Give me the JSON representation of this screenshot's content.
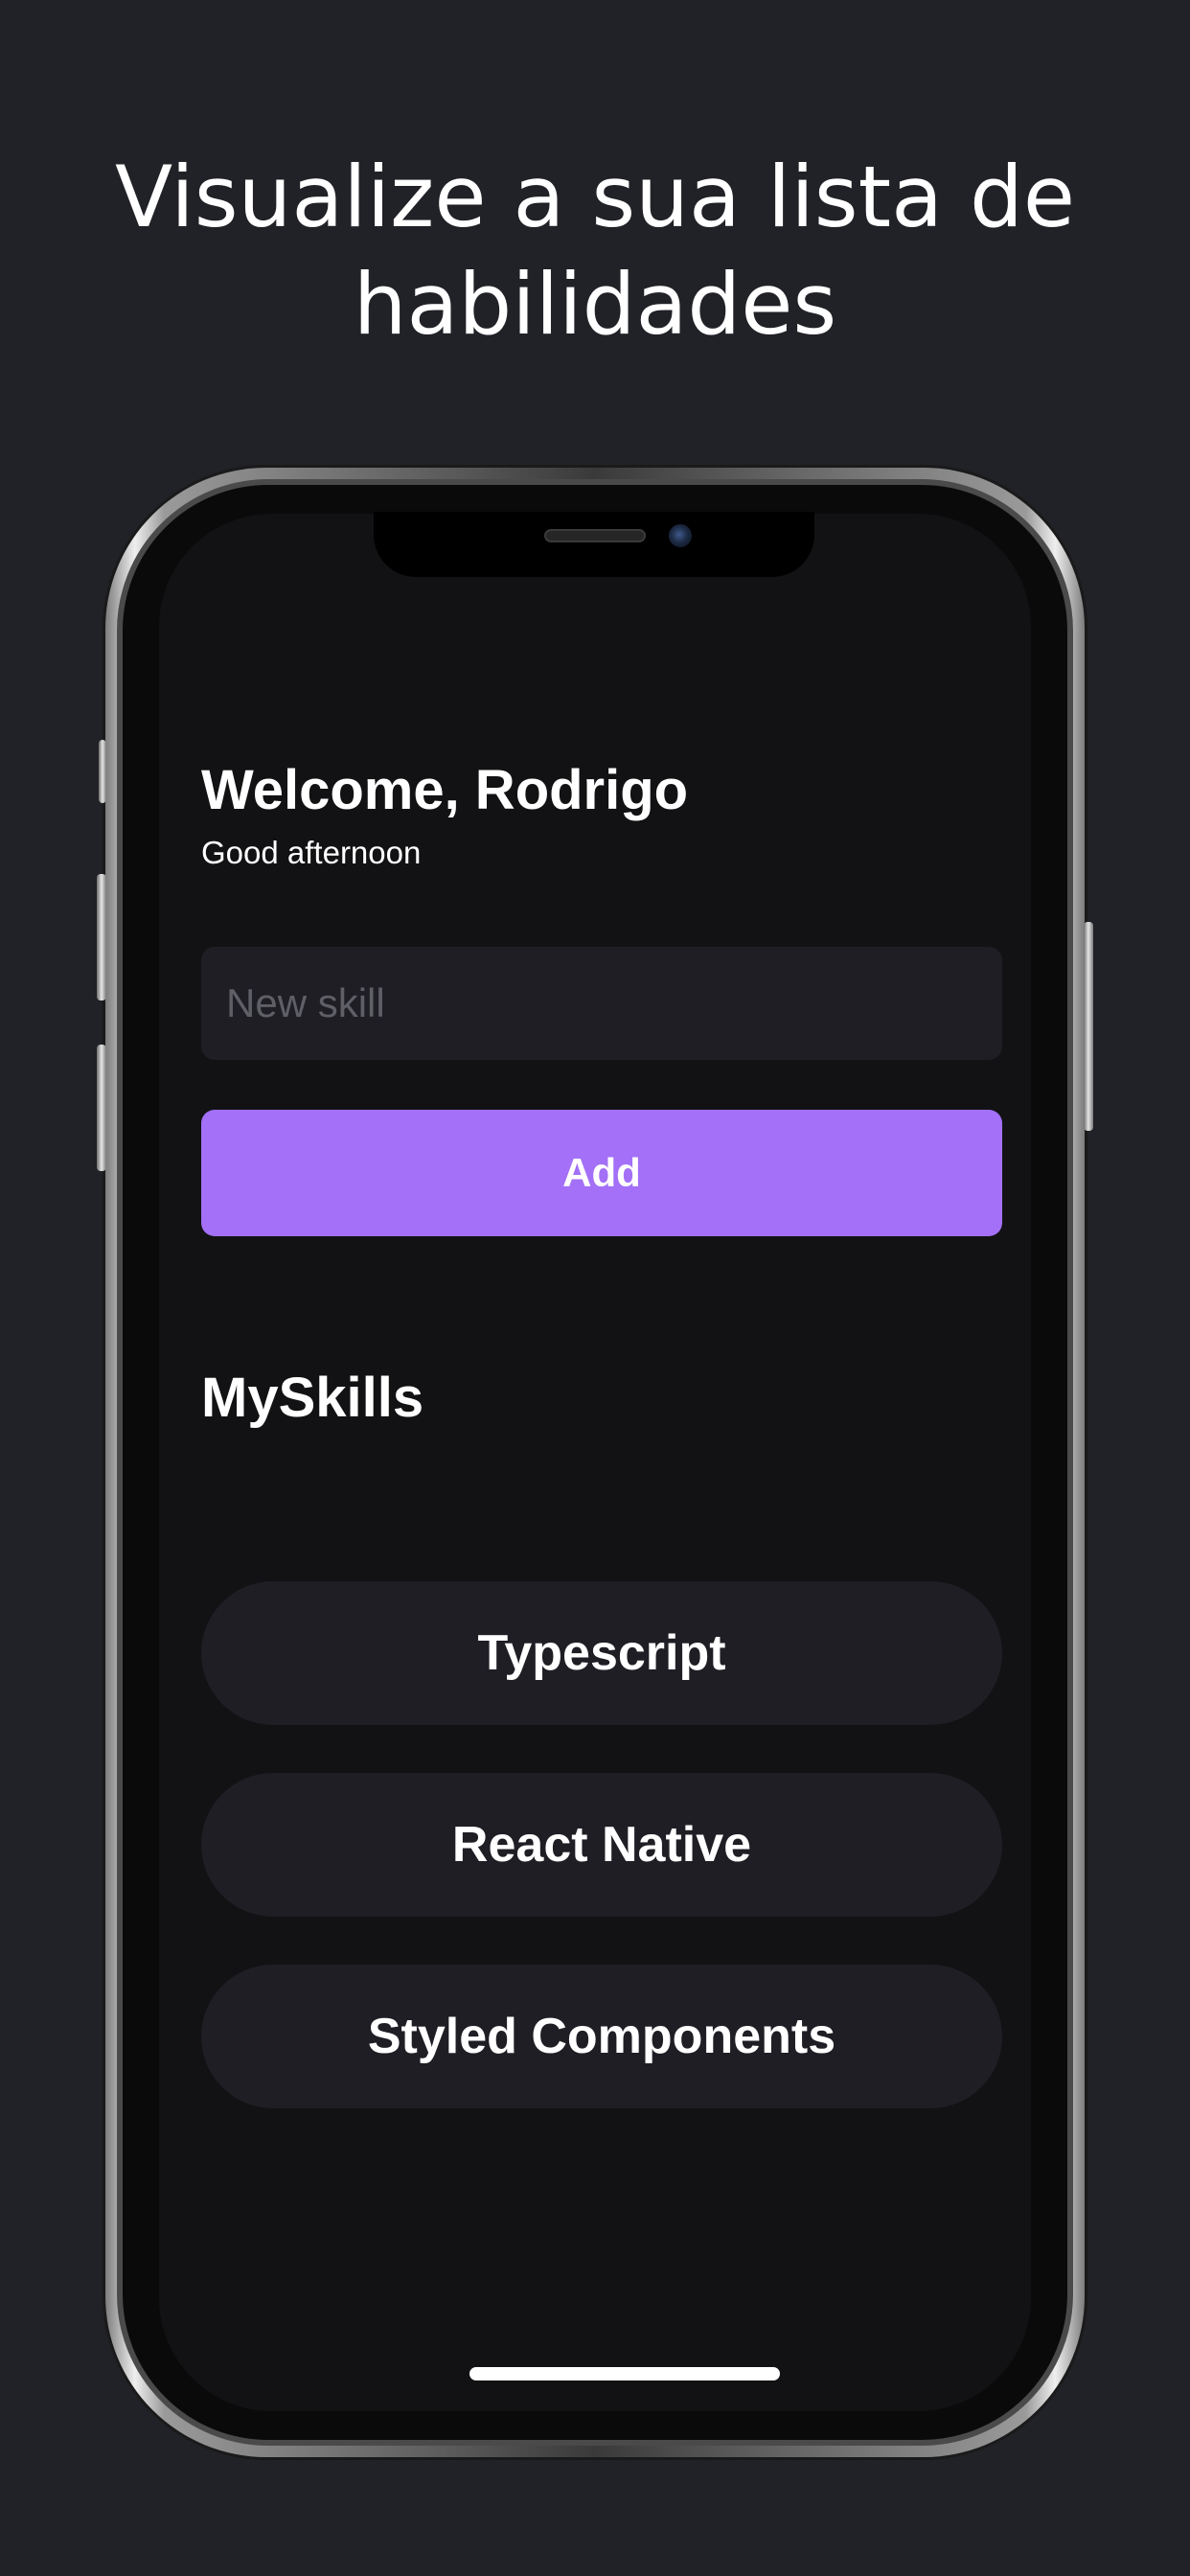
{
  "promo": {
    "title_line1": "Visualize a sua lista de",
    "title_line2": "habilidades"
  },
  "header": {
    "greeting": "Welcome, Rodrigo",
    "subtitle": "Good afternoon"
  },
  "form": {
    "input_value": "",
    "input_placeholder": "New skill",
    "add_label": "Add"
  },
  "skills": {
    "title": "MySkills",
    "items": [
      {
        "label": "Typescript"
      },
      {
        "label": "React Native"
      },
      {
        "label": "Styled Components"
      }
    ]
  },
  "colors": {
    "background": "#202227",
    "screen": "#121214",
    "surface": "#1f1e25",
    "accent": "#a370f7",
    "text": "#ffffff",
    "placeholder": "#5f5f66"
  }
}
